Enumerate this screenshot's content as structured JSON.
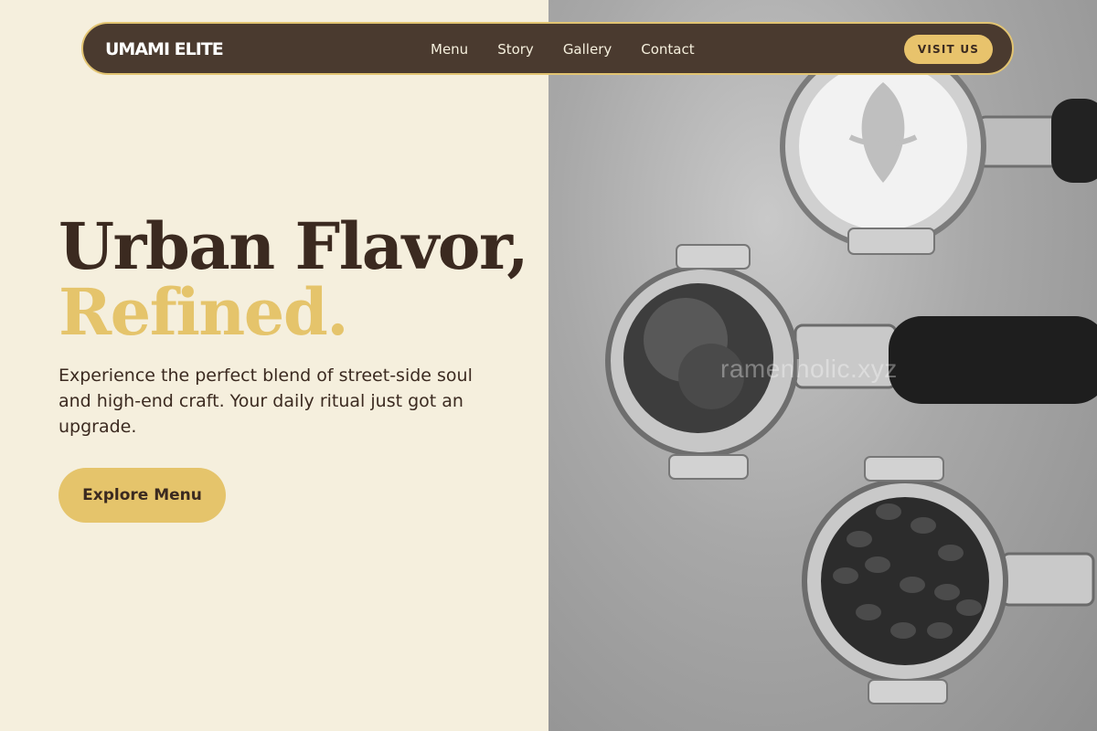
{
  "nav": {
    "brand": "UMAMI ELITE",
    "links": [
      "Menu",
      "Story",
      "Gallery",
      "Contact"
    ],
    "cta": "VISIT US"
  },
  "hero": {
    "title_line1": "Urban Flavor,",
    "title_line2": "Refined.",
    "subtitle": "Experience the perfect blend of street-side soul and high-end craft. Your daily ritual just got an upgrade.",
    "button": "Explore Menu"
  },
  "image": {
    "watermark": "ramenholic.xyz",
    "description_icon": "portafilter-coffee-photo-icon"
  },
  "colors": {
    "background": "#f5efdd",
    "nav_bg": "#4a3a2f",
    "accent": "#e5c46b",
    "text_dark": "#3b2a20"
  }
}
